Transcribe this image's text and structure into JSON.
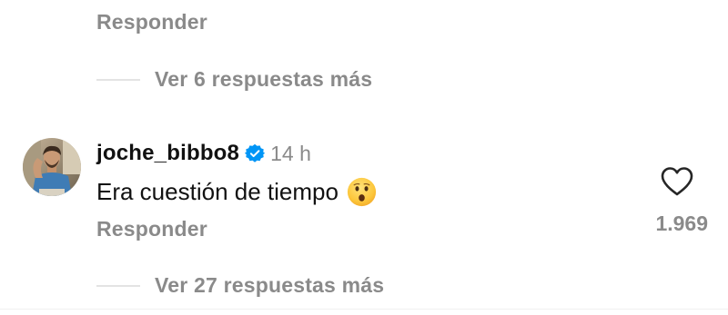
{
  "top_reply": {
    "reply_label": "Responder",
    "view_more_label": "Ver 6 respuestas más"
  },
  "comment": {
    "username": "joche_bibbo8",
    "verified": true,
    "time": "14 h",
    "text": "Era cuestión de tiempo",
    "emoji": "hushed-face",
    "reply_label": "Responder",
    "like_count": "1.969",
    "view_more_label": "Ver 27 respuestas más"
  },
  "colors": {
    "text_primary": "#111111",
    "text_secondary": "#8a8a8a",
    "verified_blue": "#0095f6",
    "divider": "#e3e3e3"
  }
}
